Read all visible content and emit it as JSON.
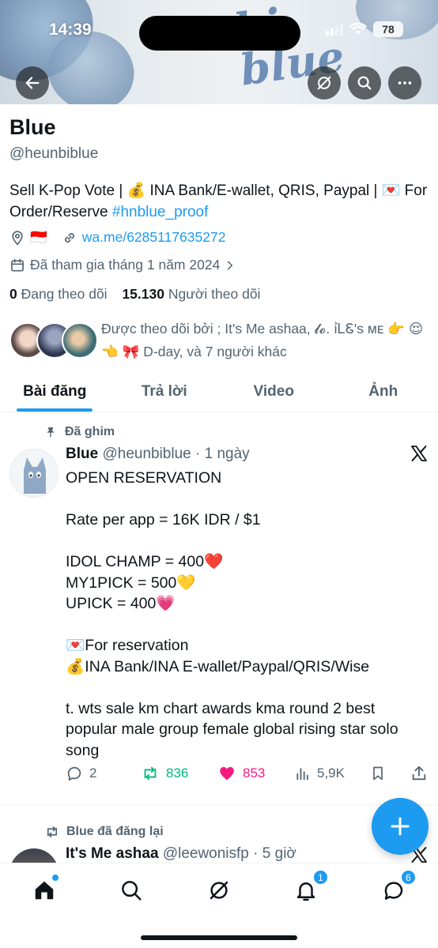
{
  "status": {
    "time": "14:39",
    "battery": "78"
  },
  "banner": {
    "deco_text": "bi\nblue"
  },
  "profile": {
    "name": "Blue",
    "handle": "@heunbiblue",
    "bio_text": "Sell K-Pop Vote | 💰 INA Bank/E-wallet, QRIS, Paypal | 💌 For Order/Reserve ",
    "bio_hashtag": "#hnblue_proof",
    "location_flag": "🇮🇩",
    "website": "wa.me/6285117635272",
    "joined": "Đã tham gia tháng 1 năm 2024",
    "following_count": "0",
    "following_label": " Đang theo dõi",
    "followers_count": "15.130",
    "followers_label": " Người theo dõi",
    "followed_by": "Được theo dõi bởi ; It's Me ashaa, 𝓵𝓸. í̇ᏞᏋ's ᴍᴇ 👉 😌👈 🎀 D-day, và 7 người khác"
  },
  "tabs": [
    {
      "label": "Bài đăng",
      "active": true
    },
    {
      "label": "Trả lời",
      "active": false
    },
    {
      "label": "Video",
      "active": false
    },
    {
      "label": "Ảnh",
      "active": false
    }
  ],
  "pinned_post": {
    "pin_label": "Đã ghim",
    "author": "Blue",
    "handle": "@heunbiblue",
    "time": " · 1 ngày",
    "lines": [
      "OPEN RESERVATION",
      "",
      "Rate per app = 16K IDR / $1",
      "",
      "IDOL CHAMP = 400❤️",
      "MY1PICK = 500💛",
      "UPICK = 400💗",
      "",
      "💌For reservation",
      "💰INA Bank/INA E-wallet/Paypal/QRIS/Wise",
      "",
      "t. wts sale km chart awards kma round 2 best popular male group female global rising star solo song"
    ],
    "replies": "2",
    "reposts": "836",
    "likes": "853",
    "views": "5,9K"
  },
  "repost": {
    "label": "Blue đã đăng lại",
    "author": "It's Me ashaa",
    "handle": "@leewonisfp",
    "time": " · 5 giờ"
  },
  "nav": {
    "notifications_badge": "1",
    "messages_badge": "6"
  },
  "colors": {
    "accent": "#1d9bf0",
    "repost_green": "#00ba7c",
    "like_pink": "#f91880"
  }
}
